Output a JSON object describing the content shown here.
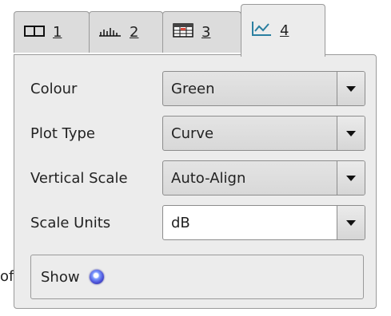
{
  "stray_text": "of",
  "tabs": [
    {
      "number": "1",
      "icon": "panel-split-icon"
    },
    {
      "number": "2",
      "icon": "histogram-icon"
    },
    {
      "number": "3",
      "icon": "table-grid-icon"
    },
    {
      "number": "4",
      "icon": "line-chart-icon"
    }
  ],
  "active_tab": "4",
  "fields": [
    {
      "label": "Colour",
      "value": "Green",
      "editable": false
    },
    {
      "label": "Plot Type",
      "value": "Curve",
      "editable": false
    },
    {
      "label": "Vertical Scale",
      "value": "Auto-Align",
      "editable": false
    },
    {
      "label": "Scale Units",
      "value": "dB",
      "editable": true
    }
  ],
  "show": {
    "label": "Show",
    "indicator_color": "#4a4fd6"
  },
  "colors": {
    "active_tab_icon": "#2a7fa0",
    "panel_bg": "#ececec"
  }
}
